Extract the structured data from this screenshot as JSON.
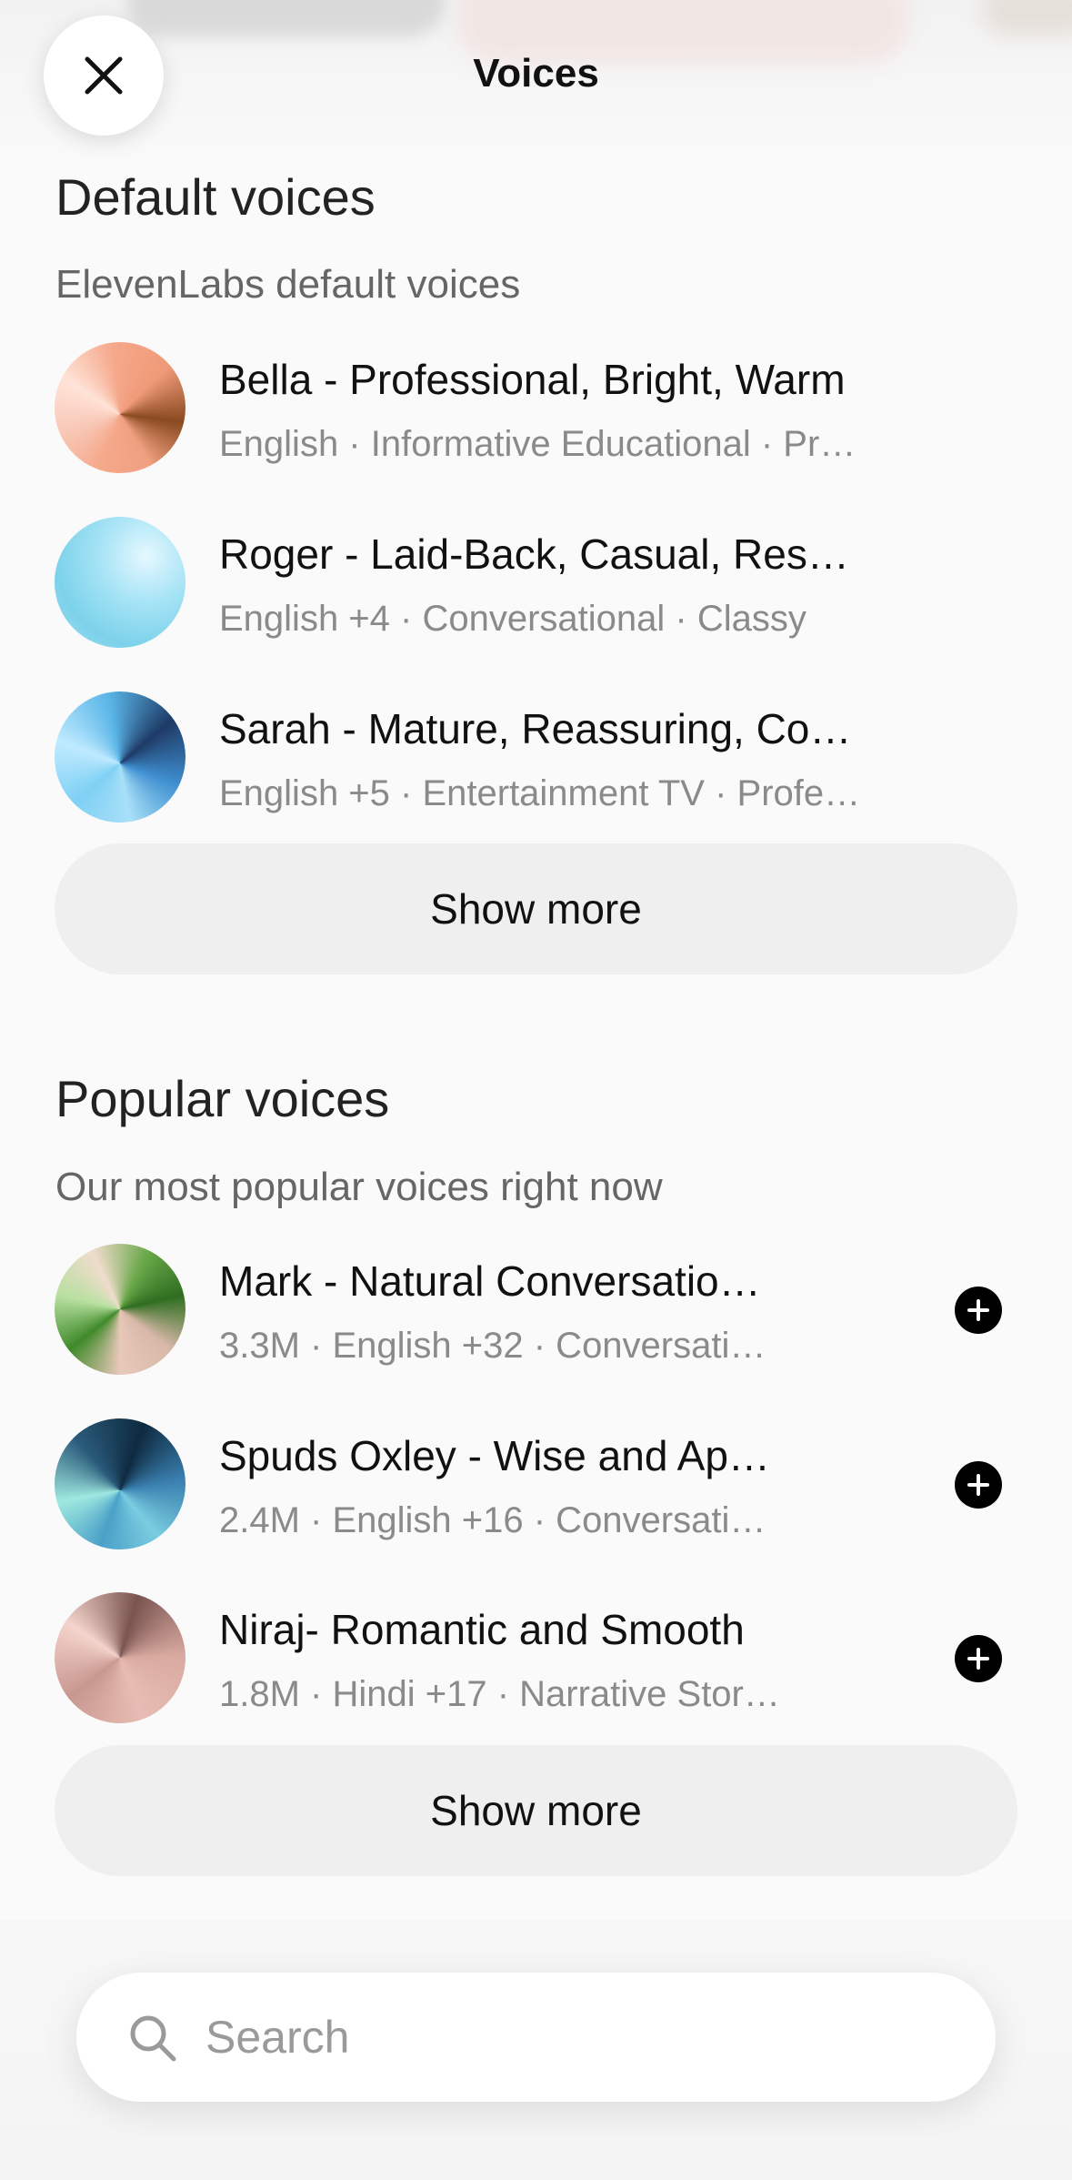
{
  "header": {
    "title": "Voices",
    "close_icon": "close-icon"
  },
  "default_section": {
    "title": "Default voices",
    "subtitle": "ElevenLabs default voices",
    "voices": [
      {
        "name": "Bella - Professional, Bright, Warm",
        "meta": "English · Informative Educational · Pr…"
      },
      {
        "name": "Roger - Laid-Back, Casual, Res…",
        "meta": "English +4 · Conversational · Classy"
      },
      {
        "name": "Sarah - Mature, Reassuring, Co…",
        "meta": "English +5 · Entertainment TV · Profe…"
      }
    ],
    "show_more_label": "Show more"
  },
  "popular_section": {
    "title": "Popular voices",
    "subtitle": "Our most popular voices right now",
    "voices": [
      {
        "name": "Mark - Natural Conversatio…",
        "meta": "3.3M · English +32 · Conversati…",
        "add_icon": "plus-circle-icon"
      },
      {
        "name": "Spuds Oxley - Wise and Ap…",
        "meta": "2.4M · English +16 · Conversati…",
        "add_icon": "plus-circle-icon"
      },
      {
        "name": "Niraj- Romantic and Smooth",
        "meta": "1.8M · Hindi +17 · Narrative Stor…",
        "add_icon": "plus-circle-icon"
      }
    ],
    "show_more_label": "Show more"
  },
  "search": {
    "placeholder": "Search",
    "icon": "search-icon"
  },
  "colors": {
    "background": "#fafafa",
    "button": "#efefef",
    "text": "#111111",
    "muted": "#8a8a8a"
  }
}
